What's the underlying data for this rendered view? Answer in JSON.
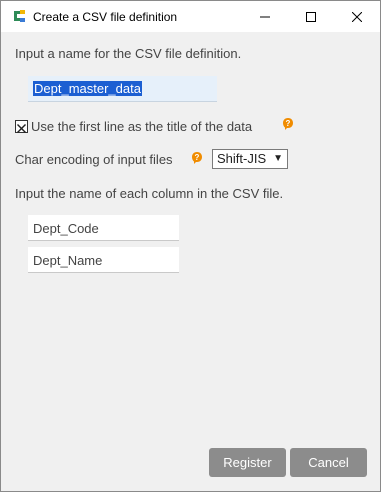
{
  "window": {
    "title": "Create a CSV file definition",
    "minimize_symbol": "—",
    "maximize_symbol": "☐",
    "close_symbol": "✕"
  },
  "form": {
    "name_label": "Input a name for the CSV file definition.",
    "name_value": "Dept_master_data",
    "first_line_title": {
      "label": "Use the first line as the title of the data",
      "checked": true
    },
    "encoding": {
      "label": "Char encoding of input files",
      "selected": "Shift-JIS"
    },
    "columns_label": "Input the name of each column in the CSV file.",
    "columns": [
      "Dept_Code",
      "Dept_Name"
    ]
  },
  "actions": {
    "register_label": "Register",
    "cancel_label": "Cancel"
  },
  "colors": {
    "help_icon": "#f08c00",
    "button_bg": "#8c8c8c",
    "selection": "#1c5fd2"
  },
  "icons": [
    "app-icon",
    "help-icon",
    "checkbox-checked-icon",
    "dropdown-arrow-icon"
  ]
}
